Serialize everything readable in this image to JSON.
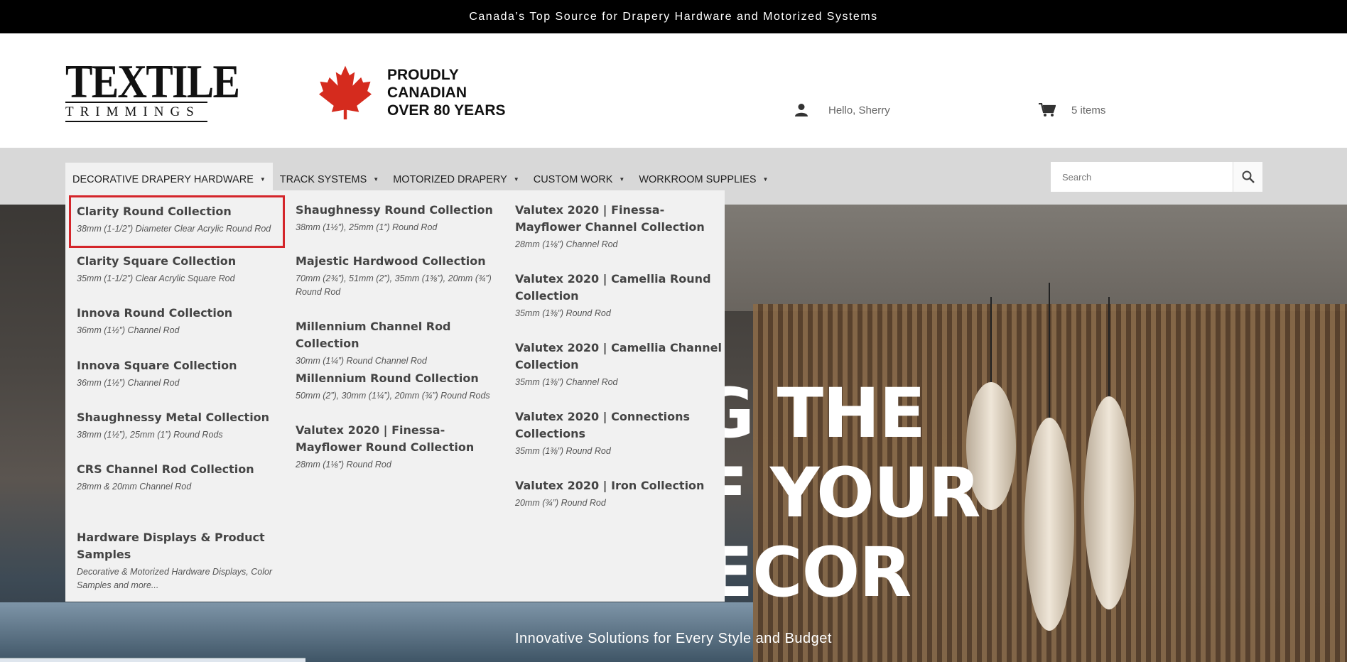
{
  "topbar": {
    "text": "Canada’s Top Source for Drapery Hardware and Motorized Systems"
  },
  "header": {
    "logo_line1": "TEXTILE",
    "logo_line2": "TRIMMINGS",
    "canada_line1": "PROUDLY",
    "canada_line2": "CANADIAN",
    "canada_line3": "OVER 80 YEARS",
    "user_greeting": "Hello, Sherry",
    "cart_count": "5 items",
    "icons": {
      "user": "user-icon",
      "cart": "cart-icon",
      "leaf": "maple-leaf-icon",
      "search": "search-icon"
    }
  },
  "nav": {
    "items": [
      {
        "label": "DECORATIVE DRAPERY HARDWARE"
      },
      {
        "label": "TRACK SYSTEMS"
      },
      {
        "label": "MOTORIZED DRAPERY"
      },
      {
        "label": "CUSTOM WORK"
      },
      {
        "label": "WORKROOM SUPPLIES"
      }
    ],
    "search_placeholder": "Search"
  },
  "mega_menu": {
    "columns": [
      [
        {
          "title": "Clarity Round Collection",
          "desc": "38mm (1-1/2”) Diameter Clear Acrylic Round Rod"
        },
        {
          "title": "Clarity Square Collection",
          "desc": "35mm (1-1/2”) Clear Acrylic Square Rod"
        },
        {
          "title": "Innova Round Collection",
          "desc": "36mm (1½”) Channel Rod"
        },
        {
          "title": "Innova Square Collection",
          "desc": "36mm (1½”) Channel Rod"
        },
        {
          "title": "Shaughnessy Metal Collection",
          "desc": "38mm (1½”), 25mm (1”) Round Rods"
        },
        {
          "title": "CRS Channel Rod Collection",
          "desc": "28mm & 20mm Channel Rod"
        },
        {
          "title": "Hardware Displays & Product Samples",
          "desc": "Decorative & Motorized Hardware Displays, Color Samples and more..."
        }
      ],
      [
        {
          "title": "Shaughnessy Round Collection",
          "desc": "38mm (1½”), 25mm (1”) Round Rod"
        },
        {
          "title": "Majestic Hardwood Collection",
          "desc": "70mm (2¾”), 51mm (2”), 35mm (1⅜”), 20mm (¾”) Round Rod"
        },
        {
          "title": "Millennium Channel Rod Collection",
          "desc": "30mm (1¼”) Round Channel Rod"
        },
        {
          "title": "Millennium Round Collection",
          "desc": "50mm (2”), 30mm (1¼”), 20mm (¾”) Round Rods"
        },
        {
          "title": "Valutex 2020 | Finessa-Mayflower Round Collection",
          "desc": "28mm (1⅛”) Round Rod"
        }
      ],
      [
        {
          "title": "Valutex 2020 | Finessa-Mayflower Channel Collection",
          "desc": "28mm (1⅛”) Channel Rod"
        },
        {
          "title": "Valutex 2020 | Camellia Round Collection",
          "desc": "35mm (1⅜”) Round Rod"
        },
        {
          "title": "Valutex 2020 | Camellia Channel Collection",
          "desc": "35mm (1⅜”) Channel Rod"
        },
        {
          "title": "Valutex 2020 | Connections Collections",
          "desc": "35mm (1⅜”) Round Rod"
        },
        {
          "title": "Valutex 2020 | Iron Collection",
          "desc": "20mm (¾”) Round Rod"
        }
      ]
    ]
  },
  "hero": {
    "line1": "NG THE",
    "line2": "OF YOUR",
    "line3": "DECOR",
    "subtitle": "Innovative Solutions for Every Style and Budget"
  },
  "colors": {
    "accent_red": "#d4252a",
    "topbar": "#000000",
    "navbar": "#d8d8d8",
    "menu_bg": "#f1f1f1"
  }
}
